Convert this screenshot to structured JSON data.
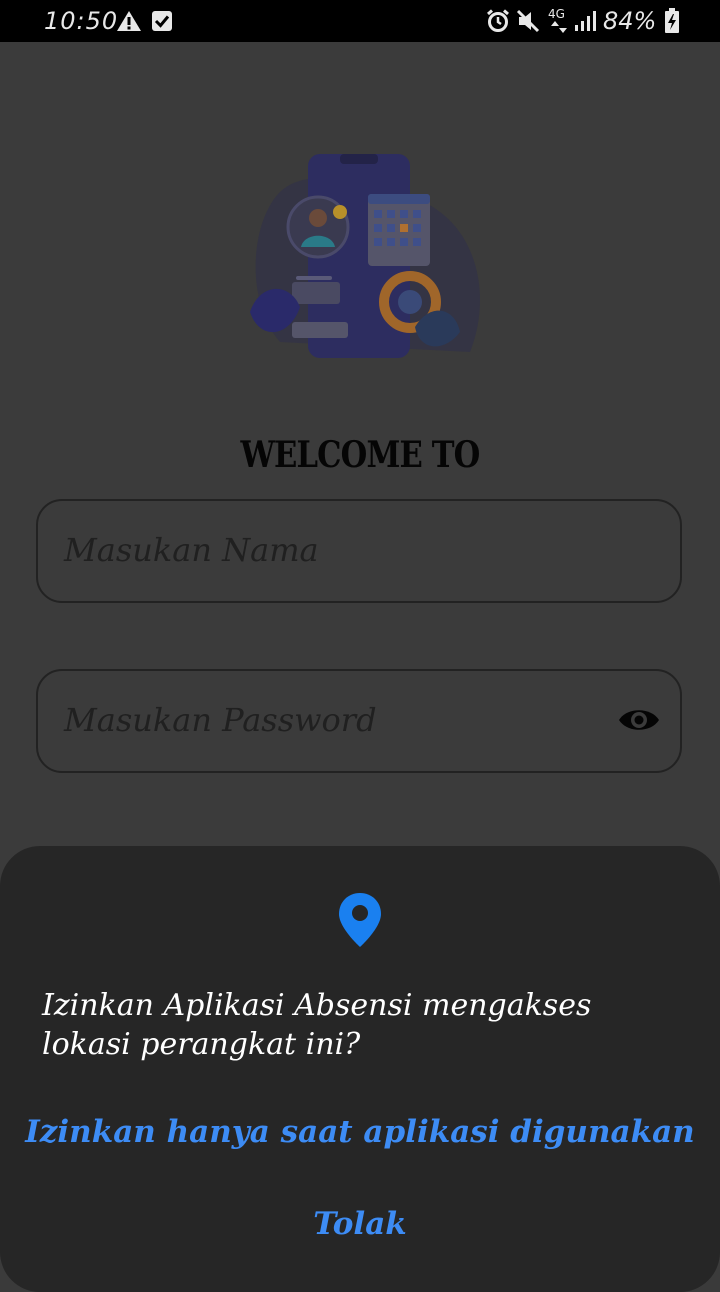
{
  "status_bar": {
    "time": "10:50",
    "battery": "84%",
    "network": "4G",
    "icons": [
      "warning-icon",
      "checkbox-icon",
      "alarm-icon",
      "mute-icon",
      "signal-icon",
      "battery-icon"
    ]
  },
  "login": {
    "welcome": "WELCOME TO",
    "name_placeholder": "Masukan Nama",
    "password_placeholder": "Masukan Password"
  },
  "permission_dialog": {
    "message": "Izinkan Aplikasi Absensi mengakses lokasi perangkat ini?",
    "allow_label": "Izinkan hanya saat aplikasi digunakan",
    "deny_label": "Tolak",
    "accent_color": "#3d8cf5"
  }
}
